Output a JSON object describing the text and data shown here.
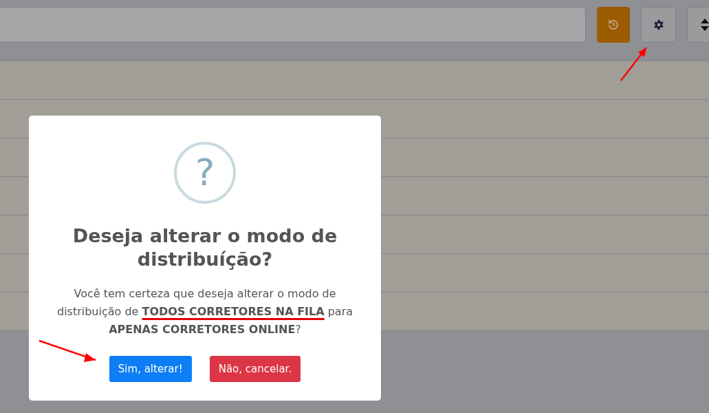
{
  "toolbar": {
    "buttons": [
      {
        "kind": "history",
        "highlighted": true
      },
      {
        "kind": "settings",
        "highlighted": false
      },
      {
        "kind": "sort",
        "highlighted": false
      }
    ]
  },
  "dialog": {
    "title": "Deseja alterar o modo de distribuíção?",
    "icon": "?",
    "message": "Você tem certeza que deseja alterar o modo de distribuição de **TODOS CORRETORES NA FILA** para **APENAS CORRETORES ONLINE**?",
    "underline_first_bold": true,
    "confirm": "Sim, alterar!",
    "cancel": "Não, cancelar."
  },
  "annotations": [
    {
      "kind": "arrow"
    },
    {
      "kind": "arrow"
    }
  ]
}
